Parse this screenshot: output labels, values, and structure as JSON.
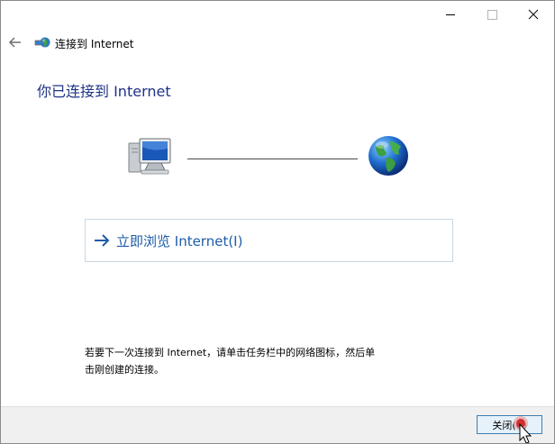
{
  "window": {
    "title": "连接到 Internet",
    "heading": "你已连接到 Internet",
    "colors": {
      "heading": "#1e3287",
      "link": "#1d5ca8",
      "footer_bg": "#f0f0f0",
      "button_border": "#3c7fb1"
    }
  },
  "caption_buttons": {
    "minimize_icon": "minimize-icon",
    "maximize_icon": "maximize-icon",
    "close_icon": "close-icon"
  },
  "diagram": {
    "left_icon": "computer-icon",
    "right_icon": "globe-icon"
  },
  "browse_link": {
    "label": "立即浏览 Internet(I)",
    "icon": "arrow-right-icon"
  },
  "info": {
    "line1": "若要下一次连接到 Internet，请单击任务栏中的网络图标，然后单",
    "line2": "击刚创建的连接。"
  },
  "footer": {
    "close_label": "关闭(C)"
  }
}
